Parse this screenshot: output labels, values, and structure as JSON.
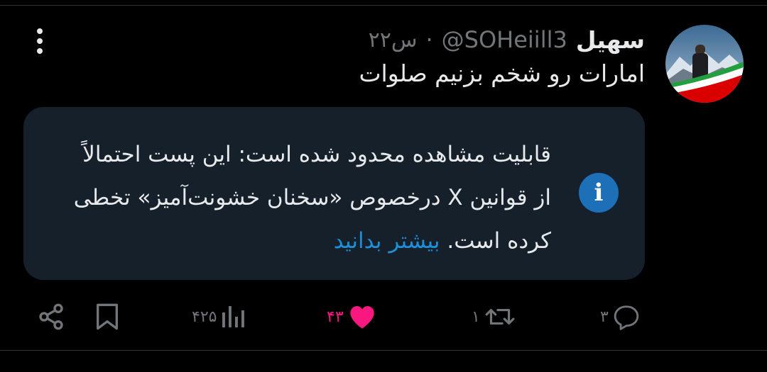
{
  "tweet": {
    "display_name": "سهیل",
    "handle": "@SOHeiill3",
    "separator": "·",
    "time": "۲۲س",
    "text": "امارات رو شخم بزنیم صلوات"
  },
  "notice": {
    "message": "قابلیت مشاهده محدود شده است: این پست احتمالاً از قوانین X درخصوص «سخنان خشونت‌آمیز» تخطی کرده است.",
    "link_label": "بیشتر بدانید",
    "icon": "info-icon"
  },
  "actions": {
    "replies": "۳",
    "retweets": "۱",
    "likes": "۴۳",
    "views": "۴۲۵"
  },
  "colors": {
    "background": "#000000",
    "card": "#15202b",
    "link": "#1d8ed8",
    "like": "#f91880",
    "muted": "#71767b"
  }
}
